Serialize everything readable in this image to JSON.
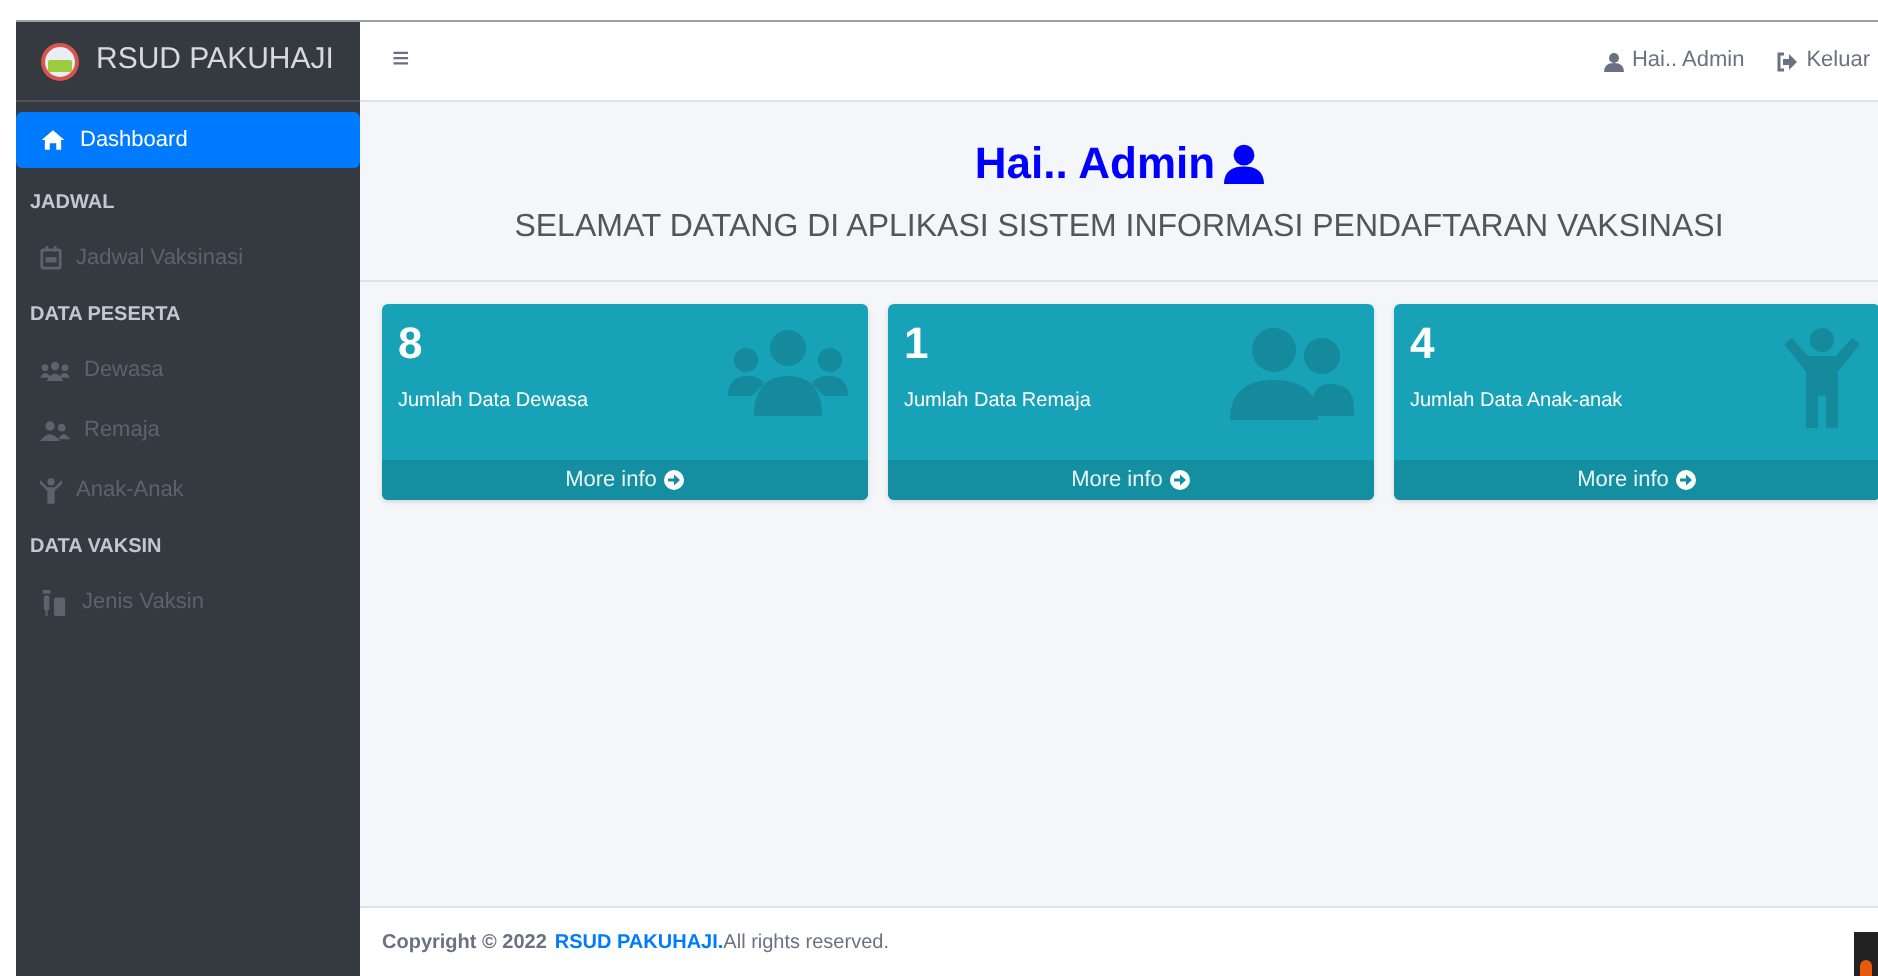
{
  "sidebar": {
    "brand": "RSUD PAKUHAJI",
    "items": [
      {
        "kind": "item",
        "label": "Dashboard",
        "selected": true
      },
      {
        "kind": "header",
        "label": "JADWAL"
      },
      {
        "kind": "item",
        "label": "Jadwal Vaksinasi",
        "selected": false
      },
      {
        "kind": "header",
        "label": "DATA PESERTA"
      },
      {
        "kind": "item",
        "label": "Dewasa",
        "selected": false
      },
      {
        "kind": "item",
        "label": "Remaja",
        "selected": false
      },
      {
        "kind": "item",
        "label": "Anak-Anak",
        "selected": false
      },
      {
        "kind": "header",
        "label": "DATA VAKSIN"
      },
      {
        "kind": "item",
        "label": "Jenis Vaksin",
        "selected": false
      }
    ]
  },
  "topbar": {
    "menu": "≡",
    "user": "Hai.. Admin",
    "logout": "Keluar"
  },
  "welcome": {
    "title": "Hai.. Admin",
    "subtitle": "SELAMAT DATANG DI APLIKASI SISTEM INFORMASI PENDAFTARAN VAKSINASI"
  },
  "cards": [
    {
      "value": "8",
      "label": "Jumlah Data Dewasa",
      "link": "More info"
    },
    {
      "value": "1",
      "label": "Jumlah Data Remaja",
      "link": "More info"
    },
    {
      "value": "4",
      "label": "Jumlah Data Anak-anak",
      "link": "More info"
    }
  ],
  "footer": {
    "prefix": "Copyright © 2022",
    "link": "RSUD PAKUHAJI.",
    "suffix": "All rights reserved."
  }
}
